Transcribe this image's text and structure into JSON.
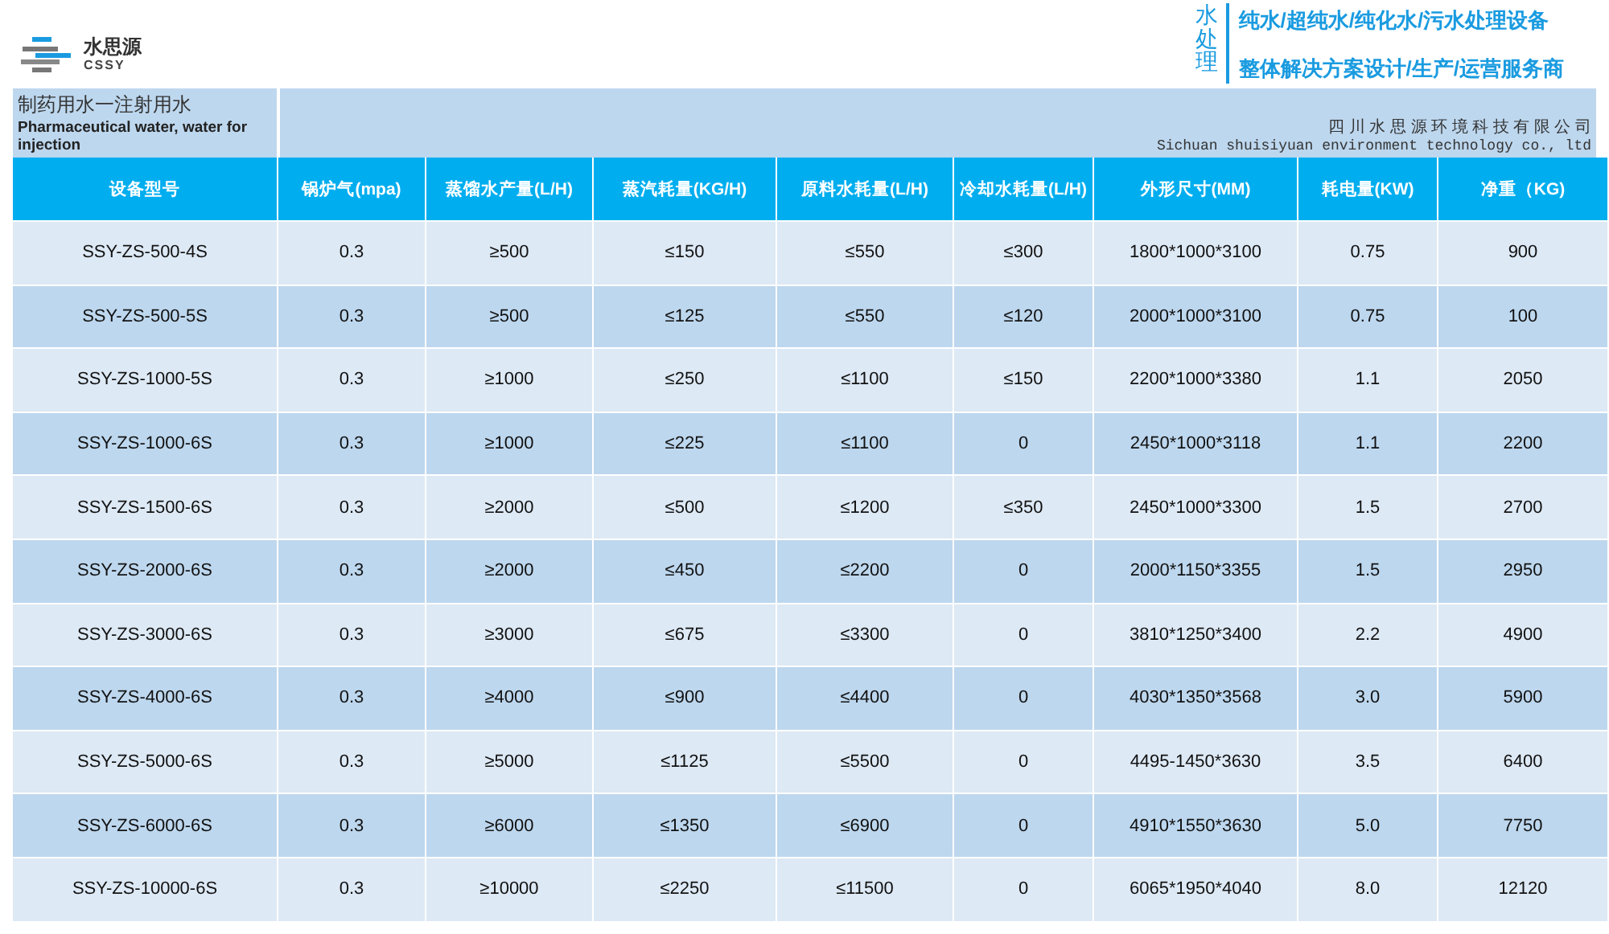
{
  "brand": {
    "name": "水思源",
    "sub": "CSSY"
  },
  "slogan": {
    "tag": "水处理",
    "lines": [
      "纯水/超纯水/纯化水/污水处理设备",
      "整体解决方案设计/生产/运营服务商"
    ]
  },
  "banner": {
    "title_cn": "制药用水一注射用水",
    "title_en": "Pharmaceutical water, water for injection",
    "company_cn": "四 川 水 思 源 环 境 科 技 有 限 公 司",
    "company_en": "Sichuan shuisiyuan environment technology co., ltd"
  },
  "table": {
    "columns": [
      "设备型号",
      "锅炉气(mpa)",
      "蒸馏水产量(L/H)",
      "蒸汽耗量(KG/H)",
      "原料水耗量(L/H)",
      "冷却水耗量(L/H)",
      "外形尺寸(MM)",
      "耗电量(KW)",
      "净重（KG)"
    ],
    "rows": [
      [
        "SSY-ZS-500-4S",
        "0.3",
        "≥500",
        "≤150",
        "≤550",
        "≤300",
        "1800*1000*3100",
        "0.75",
        "900"
      ],
      [
        "SSY-ZS-500-5S",
        "0.3",
        "≥500",
        "≤125",
        "≤550",
        "≤120",
        "2000*1000*3100",
        "0.75",
        "100"
      ],
      [
        "SSY-ZS-1000-5S",
        "0.3",
        "≥1000",
        "≤250",
        "≤1100",
        "≤150",
        "2200*1000*3380",
        "1.1",
        "2050"
      ],
      [
        "SSY-ZS-1000-6S",
        "0.3",
        "≥1000",
        "≤225",
        "≤1100",
        "0",
        "2450*1000*3118",
        "1.1",
        "2200"
      ],
      [
        "SSY-ZS-1500-6S",
        "0.3",
        "≥2000",
        "≤500",
        "≤1200",
        "≤350",
        "2450*1000*3300",
        "1.5",
        "2700"
      ],
      [
        "SSY-ZS-2000-6S",
        "0.3",
        "≥2000",
        "≤450",
        "≤2200",
        "0",
        "2000*1150*3355",
        "1.5",
        "2950"
      ],
      [
        "SSY-ZS-3000-6S",
        "0.3",
        "≥3000",
        "≤675",
        "≤3300",
        "0",
        "3810*1250*3400",
        "2.2",
        "4900"
      ],
      [
        "SSY-ZS-4000-6S",
        "0.3",
        "≥4000",
        "≤900",
        "≤4400",
        "0",
        "4030*1350*3568",
        "3.0",
        "5900"
      ],
      [
        "SSY-ZS-5000-6S",
        "0.3",
        "≥5000",
        "≤1125",
        "≤5500",
        "0",
        "4495-1450*3630",
        "3.5",
        "6400"
      ],
      [
        "SSY-ZS-6000-6S",
        "0.3",
        "≥6000",
        "≤1350",
        "≤6900",
        "0",
        "4910*1550*3630",
        "5.0",
        "7750"
      ],
      [
        "SSY-ZS-10000-6S",
        "0.3",
        "≥10000",
        "≤2250",
        "≤11500",
        "0",
        "6065*1950*4040",
        "8.0",
        "12120"
      ]
    ]
  }
}
